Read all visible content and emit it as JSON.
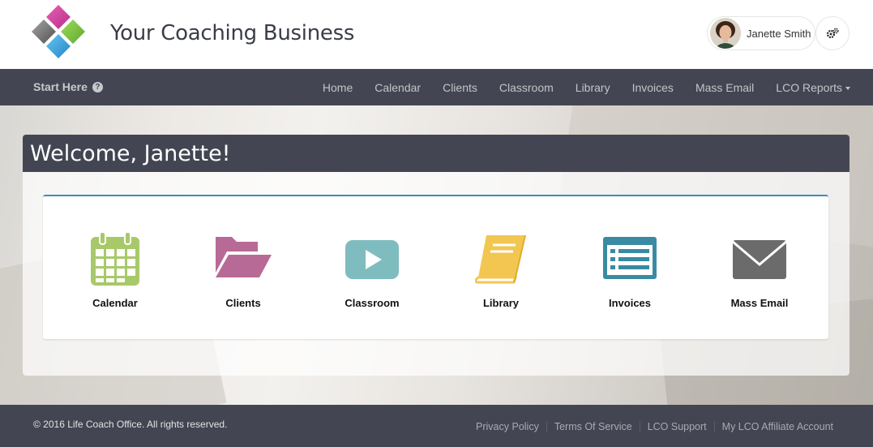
{
  "header": {
    "business_name": "Your Coaching Business",
    "user_name": "Janette Smith"
  },
  "nav": {
    "start_here": "Start Here",
    "links": [
      "Home",
      "Calendar",
      "Clients",
      "Classroom",
      "Library",
      "Invoices",
      "Mass Email",
      "LCO Reports"
    ]
  },
  "welcome": {
    "title": "Welcome, Janette!",
    "tiles": [
      {
        "label": "Calendar",
        "icon": "calendar-icon",
        "color": "#a8c96a"
      },
      {
        "label": "Clients",
        "icon": "folder-open-icon",
        "color": "#b86a96"
      },
      {
        "label": "Classroom",
        "icon": "play-video-icon",
        "color": "#7fbcc0"
      },
      {
        "label": "Library",
        "icon": "book-icon",
        "color": "#f3c651"
      },
      {
        "label": "Invoices",
        "icon": "list-alt-icon",
        "color": "#3a8aa3"
      },
      {
        "label": "Mass Email",
        "icon": "envelope-icon",
        "color": "#6b6b6b"
      }
    ]
  },
  "footer": {
    "copyright": "© 2016 Life Coach Office. All rights reserved.",
    "links": [
      "Privacy Policy",
      "Terms Of Service",
      "LCO Support",
      "My LCO Affiliate Account"
    ]
  },
  "colors": {
    "nav_bg": "#434652",
    "accent": "#3a8fb7"
  }
}
